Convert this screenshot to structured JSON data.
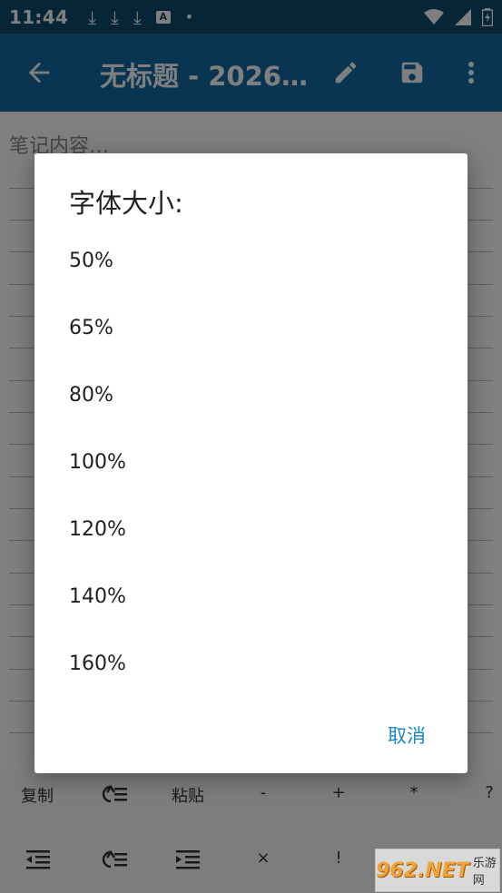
{
  "status_bar": {
    "time": "11:44",
    "icons_left": [
      "download-icon",
      "download-icon",
      "download-icon",
      "a-notification-icon",
      "dot-icon"
    ],
    "icons_right": [
      "wifi-icon",
      "signal-icon",
      "battery-icon"
    ]
  },
  "app_bar": {
    "title": "无标题 - 2026…",
    "background": "#126aa6"
  },
  "editor": {
    "placeholder": "笔记内容…"
  },
  "toolbar": {
    "row1": {
      "copy": "复制",
      "paste": "粘贴",
      "minus": "-",
      "plus": "+",
      "star": "*",
      "question": "?"
    },
    "row2": {
      "times": "×",
      "bang": "!"
    }
  },
  "dialog": {
    "title": "字体大小:",
    "options": [
      "50%",
      "65%",
      "80%",
      "100%",
      "120%",
      "140%",
      "160%"
    ],
    "cancel": "取消",
    "accent": "#1a87c7"
  },
  "watermark": {
    "brand": "962.NET",
    "sub": "乐游网"
  }
}
